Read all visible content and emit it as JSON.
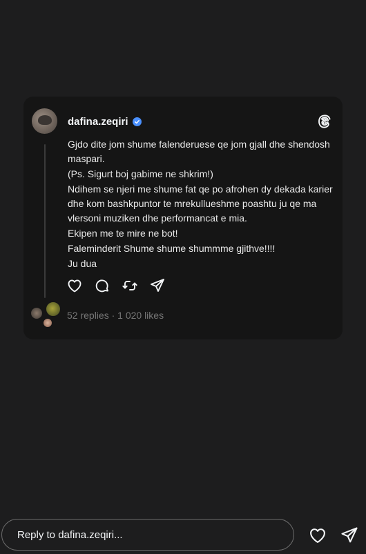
{
  "post": {
    "username": "dafina.zeqiri",
    "verified": true,
    "lines": [
      "Gjdo  dite jom shume falenderuese qe jom gjall dhe shendosh maspari.",
      "(Ps. Sigurt boj gabime ne shkrim!)",
      "Ndihem se njeri me shume fat qe po afrohen dy dekada karier dhe kom bashkpuntor te mrekullueshme poashtu ju qe ma vlersoni muziken dhe performancat e mia.",
      "Ekipen me te mire ne bot!",
      "Faleminderit Shume shume shummme gjithve!!!!",
      "Ju dua"
    ],
    "stats": "52 replies · 1 020 likes"
  },
  "actions": [
    "like-icon",
    "comment-icon",
    "repost-icon",
    "share-icon"
  ],
  "reply": {
    "placeholder": "Reply to dafina.zeqiri..."
  },
  "colors": {
    "background": "#1d1d1e",
    "card": "#151515",
    "verified": "#4a90ff",
    "muted": "#777777"
  }
}
